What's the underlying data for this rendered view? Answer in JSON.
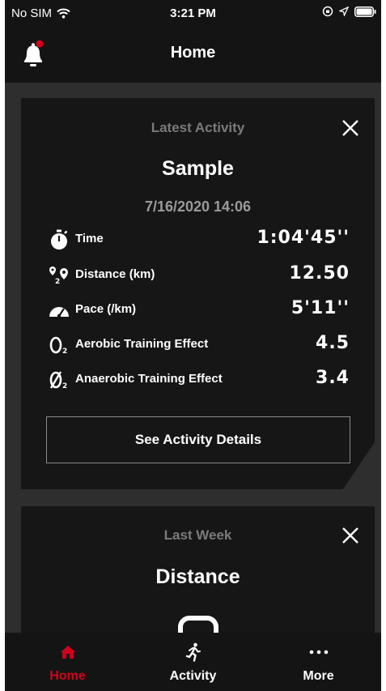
{
  "status_bar": {
    "carrier": "No SIM",
    "time": "3:21 PM"
  },
  "header": {
    "title": "Home"
  },
  "latest_card": {
    "kicker": "Latest Activity",
    "title": "Sample",
    "datetime": "7/16/2020 14:06",
    "stats": [
      {
        "icon": "stopwatch-icon",
        "label": "Time",
        "value": "1:04'45''"
      },
      {
        "icon": "distance-pins-icon",
        "label": "Distance (km)",
        "value": "12.50"
      },
      {
        "icon": "speedometer-icon",
        "label": "Pace (/km)",
        "value": "5'11''"
      },
      {
        "icon": "o2-icon",
        "label": "Aerobic Training Effect",
        "value": "4.5"
      },
      {
        "icon": "anaerobic-o2-icon",
        "label": "Anaerobic Training Effect",
        "value": "3.4"
      }
    ],
    "details_button": "See Activity Details"
  },
  "week_card": {
    "kicker": "Last Week",
    "title": "Distance"
  },
  "tabs": [
    {
      "label": "Home",
      "icon": "home-icon",
      "active": true
    },
    {
      "label": "Activity",
      "icon": "runner-icon",
      "active": false
    },
    {
      "label": "More",
      "icon": "more-dots-icon",
      "active": false
    }
  ],
  "colors": {
    "accent": "#d0021b",
    "background": "#2e2e2e",
    "card": "#161616",
    "bar": "#141414"
  }
}
